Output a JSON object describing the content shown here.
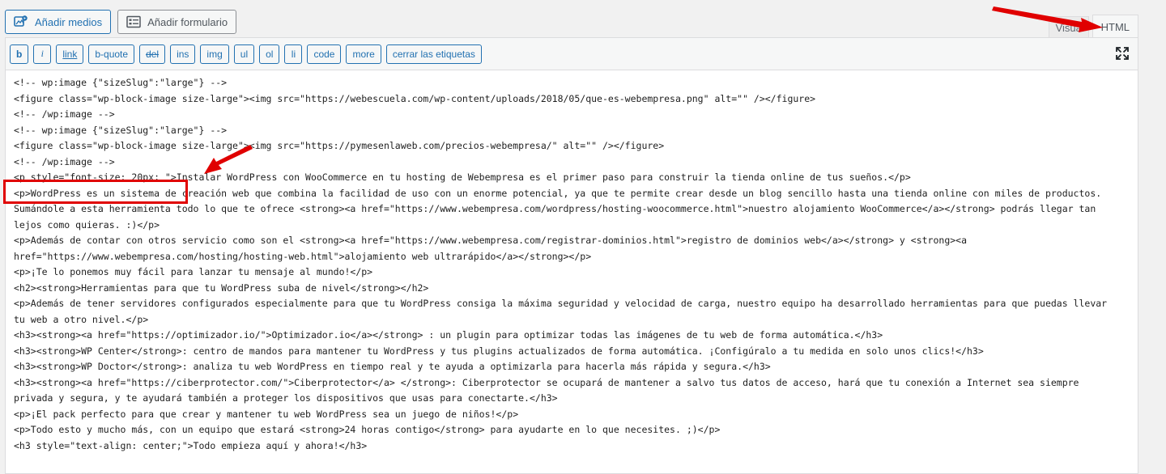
{
  "toolbar_top": {
    "add_media": "Añadir medios",
    "add_form": "Añadir formulario"
  },
  "tabs": {
    "visual": "Visual",
    "html": "HTML"
  },
  "quicktags": [
    "b",
    "i",
    "link",
    "b-quote",
    "del",
    "ins",
    "img",
    "ul",
    "ol",
    "li",
    "code",
    "more",
    "cerrar las etiquetas"
  ],
  "code_lines": [
    "<!-- wp:image {\"sizeSlug\":\"large\"} -->",
    "<figure class=\"wp-block-image size-large\"><img src=\"https://webescuela.com/wp-content/uploads/2018/05/que-es-webempresa.png\" alt=\"\" /></figure>",
    "<!-- /wp:image -->",
    "",
    "<!-- wp:image {\"sizeSlug\":\"large\"} -->",
    "<figure class=\"wp-block-image size-large\"><img src=\"https://pymesenlaweb.com/precios-webempresa/\" alt=\"\" /></figure>",
    "<!-- /wp:image -->",
    "<p style=\"font-size: 20px; \">Instalar WordPress con WooCommerce en tu hosting de Webempresa es el primer paso para construir la tienda online de tus sueños.</p>",
    "<p>WordPress es un sistema de creación web que combina la facilidad de uso con un enorme potencial, ya que te permite crear desde un blog sencillo hasta una tienda online con miles de productos.",
    "Sumándole a esta herramienta todo lo que te ofrece <strong><a href=\"https://www.webempresa.com/wordpress/hosting-woocommerce.html\">nuestro alojamiento WooCommerce</a></strong> podrás llegar tan",
    "lejos como quieras. :)</p>",
    "<p>Además de contar con otros servicio como son el <strong><a href=\"https://www.webempresa.com/registrar-dominios.html\">registro de dominios web</a></strong> y <strong><a",
    "href=\"https://www.webempresa.com/hosting/hosting-web.html\">alojamiento web ultrarápido</a></strong></p>",
    "<p>¡Te lo ponemos muy fácil para lanzar tu mensaje al mundo!</p>",
    "<h2><strong>Herramientas para que tu WordPress suba de nivel</strong></h2>",
    "<p>Además de tener servidores configurados especialmente para que tu WordPress consiga la máxima seguridad y velocidad de carga, nuestro equipo ha desarrollado herramientas para que puedas llevar",
    "tu web a otro nivel.</p>",
    "<h3><strong><a href=\"https://optimizador.io/\">Optimizador.io</a></strong> : un plugin para optimizar todas las imágenes de tu web de forma automática.</h3>",
    "<h3><strong>WP Center</strong>: centro de mandos para mantener tu WordPress y tus plugins actualizados de forma automática. ¡Configúralo a tu medida en solo unos clics!</h3>",
    "<h3><strong>WP Doctor</strong>: analiza tu web WordPress en tiempo real y te ayuda a optimizarla para hacerla más rápida y segura.</h3>",
    "<h3><strong><a href=\"https://ciberprotector.com/\">Ciberprotector</a> </strong>: Ciberprotector se ocupará de mantener a salvo tus datos de acceso, hará que tu conexión a Internet sea siempre",
    "privada y segura, y te ayudará también a proteger los dispositivos que usas para conectarte.</h3>",
    "<p>¡El pack perfecto para que crear y mantener tu web WordPress sea un juego de niños!</p>",
    "<p>Todo esto y mucho más, con un equipo que estará <strong>24 horas contigo</strong> para ayudarte en lo que necesites. ;)</p>",
    "<h3 style=\"text-align: center;\">Todo empieza aquí y ahora!</h3>"
  ],
  "colors": {
    "annotation": "#e00000",
    "accent": "#2271b1"
  }
}
